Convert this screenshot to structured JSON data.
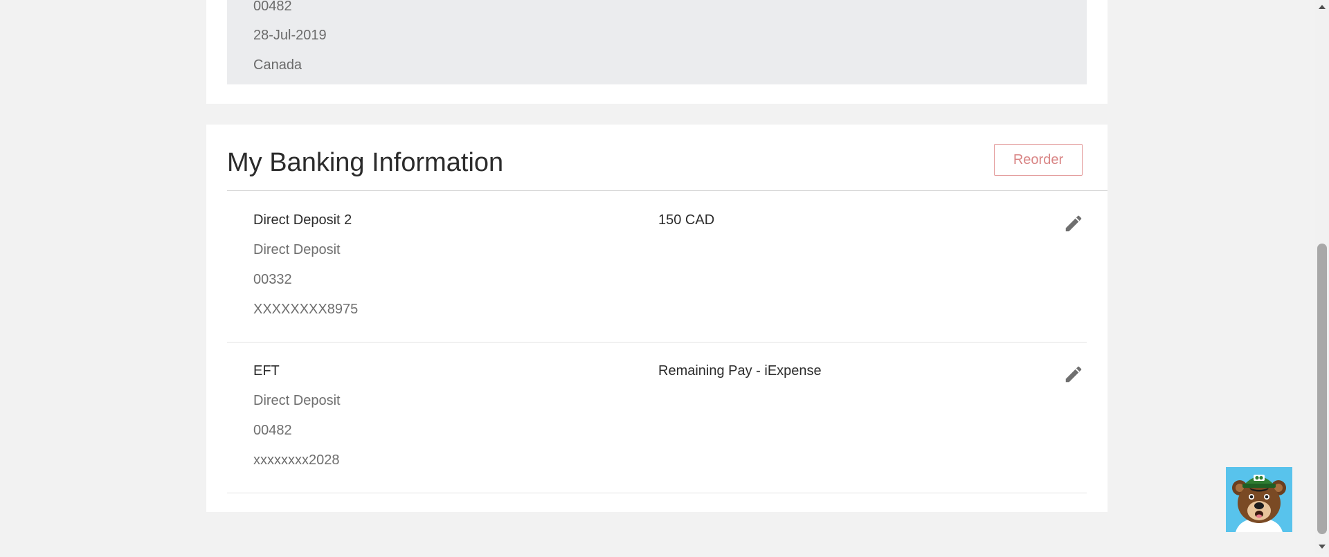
{
  "previous_section": {
    "lines": [
      "00482",
      "28-Jul-2019",
      "Canada"
    ]
  },
  "banking": {
    "title": "My Banking Information",
    "reorder_label": "Reorder",
    "deposits": [
      {
        "name": "Direct Deposit 2",
        "type": "Direct Deposit",
        "transit": "00332",
        "account": "XXXXXXXX8975",
        "amount": "150 CAD"
      },
      {
        "name": "EFT",
        "type": "Direct Deposit",
        "transit": "00482",
        "account": "xxxxxxxx2028",
        "amount": "Remaining Pay - iExpense"
      }
    ]
  },
  "icons": {
    "edit": "pencil-icon",
    "bot": "bear-chatbot-avatar"
  },
  "colors": {
    "reorder_accent": "#d98585",
    "bot_background": "#58c3ec"
  }
}
